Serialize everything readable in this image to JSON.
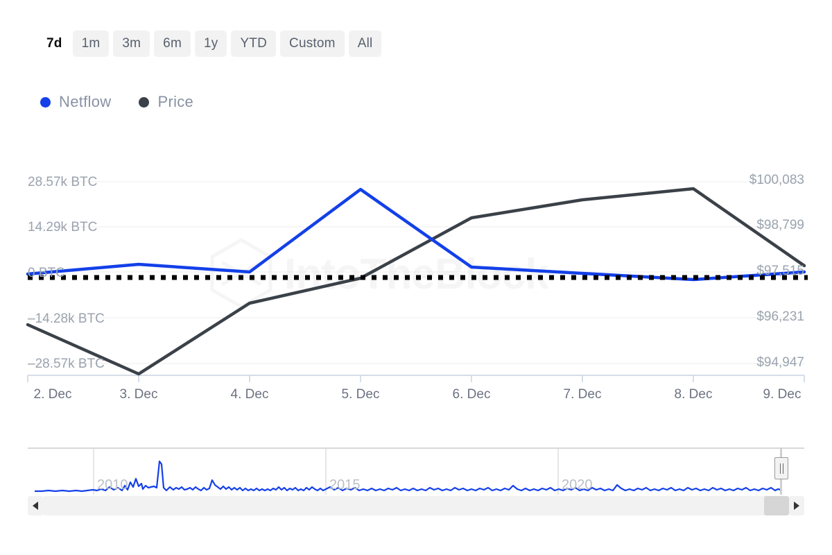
{
  "range_selector": {
    "buttons": [
      {
        "label": "7d",
        "selected": true
      },
      {
        "label": "1m",
        "selected": false
      },
      {
        "label": "3m",
        "selected": false
      },
      {
        "label": "6m",
        "selected": false
      },
      {
        "label": "1y",
        "selected": false
      },
      {
        "label": "YTD",
        "selected": false
      },
      {
        "label": "Custom",
        "selected": false
      },
      {
        "label": "All",
        "selected": false
      }
    ]
  },
  "legend": {
    "items": [
      {
        "label": "Netflow",
        "color": "#1340e8"
      },
      {
        "label": "Price",
        "color": "#3b4148"
      }
    ]
  },
  "watermark": {
    "text": "IntoTheBlock"
  },
  "navigator": {
    "years": [
      "2010",
      "2015",
      "2020"
    ],
    "left_arrow": "◀",
    "right_arrow": "▶"
  },
  "chart_data": {
    "type": "line",
    "title": "",
    "xlabel": "",
    "grid": true,
    "legend_position": "top-left",
    "x": [
      "2. Dec",
      "3. Dec",
      "4. Dec",
      "5. Dec",
      "6. Dec",
      "7. Dec",
      "8. Dec",
      "9. Dec"
    ],
    "axes": {
      "left": {
        "label": "Netflow",
        "unit": "BTC",
        "ticks": [
          "28.57k BTC",
          "14.29k BTC",
          "0 BTC",
          "–14.28k BTC",
          "–28.57k BTC"
        ],
        "tick_values": [
          28570,
          14290,
          0,
          -14280,
          -28570
        ],
        "ylim": [
          -28570,
          28570
        ]
      },
      "right": {
        "label": "Price",
        "unit": "USD",
        "ticks": [
          "$100,083",
          "$98,799",
          "$97,515",
          "$96,231",
          "$94,947"
        ],
        "tick_values": [
          100083,
          98799,
          97515,
          96231,
          94947
        ],
        "ylim": [
          94947,
          100083
        ]
      }
    },
    "zero_line": {
      "value": 0,
      "style": "dotted",
      "color": "#000000"
    },
    "series": [
      {
        "name": "Netflow",
        "axis": "left",
        "color": "#1340e8",
        "unit": "BTC",
        "values": [
          -700,
          2400,
          100,
          26200,
          1400,
          -900,
          -2500,
          -1100
        ]
      },
      {
        "name": "Price",
        "axis": "right",
        "color": "#3b4148",
        "unit": "USD",
        "values": [
          96460,
          94950,
          96790,
          97570,
          98990,
          99580,
          100090,
          97620
        ]
      }
    ],
    "navigator_series": {
      "name": "Netflow history",
      "color": "#1340e8",
      "x_ticks": [
        "2010",
        "2015",
        "2020"
      ],
      "selected_range_end": "2024-12-09"
    }
  }
}
